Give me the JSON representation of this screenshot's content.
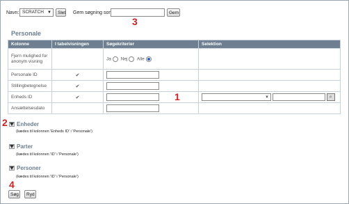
{
  "toolbar": {
    "name_label": "Navn:",
    "name_select_value": "SCRATCH",
    "delete_button": "Slet",
    "save_search_label": "Gem søgning som:",
    "save_button": "Gem"
  },
  "markers": {
    "m1": "1",
    "m2": "2",
    "m3": "3",
    "m4": "4"
  },
  "personale": {
    "title": "Personale",
    "headers": {
      "kolonne": "Kolonne",
      "tabel": "I tabelvisningen",
      "sog": "Søgekriterier",
      "sel": "Selektion"
    },
    "rows": [
      {
        "label": "Fjern mulighed for anonym visning",
        "radio_ja": "Ja",
        "radio_nej": "Nej",
        "radio_alle": "Alle",
        "radio_selected": "Alle"
      },
      {
        "label": "Personale ID",
        "check": "✔"
      },
      {
        "label": "Stillingbetegnelse",
        "check": "✔"
      },
      {
        "label": "Enheds ID",
        "check": "✔"
      },
      {
        "label": "Ansættelsesdato"
      }
    ]
  },
  "groups": [
    {
      "title": "Enheder",
      "note": "(kædes til kolonnen 'Enheds ID' i 'Personale')"
    },
    {
      "title": "Parter",
      "note": "(kædes til kolonnen 'ID' i 'Personale')"
    },
    {
      "title": "Personer",
      "note": "(kædes til kolonnen 'ID' i 'Personale')"
    }
  ],
  "actions": {
    "search_button": "Søg",
    "clear_button": "Ryd"
  }
}
